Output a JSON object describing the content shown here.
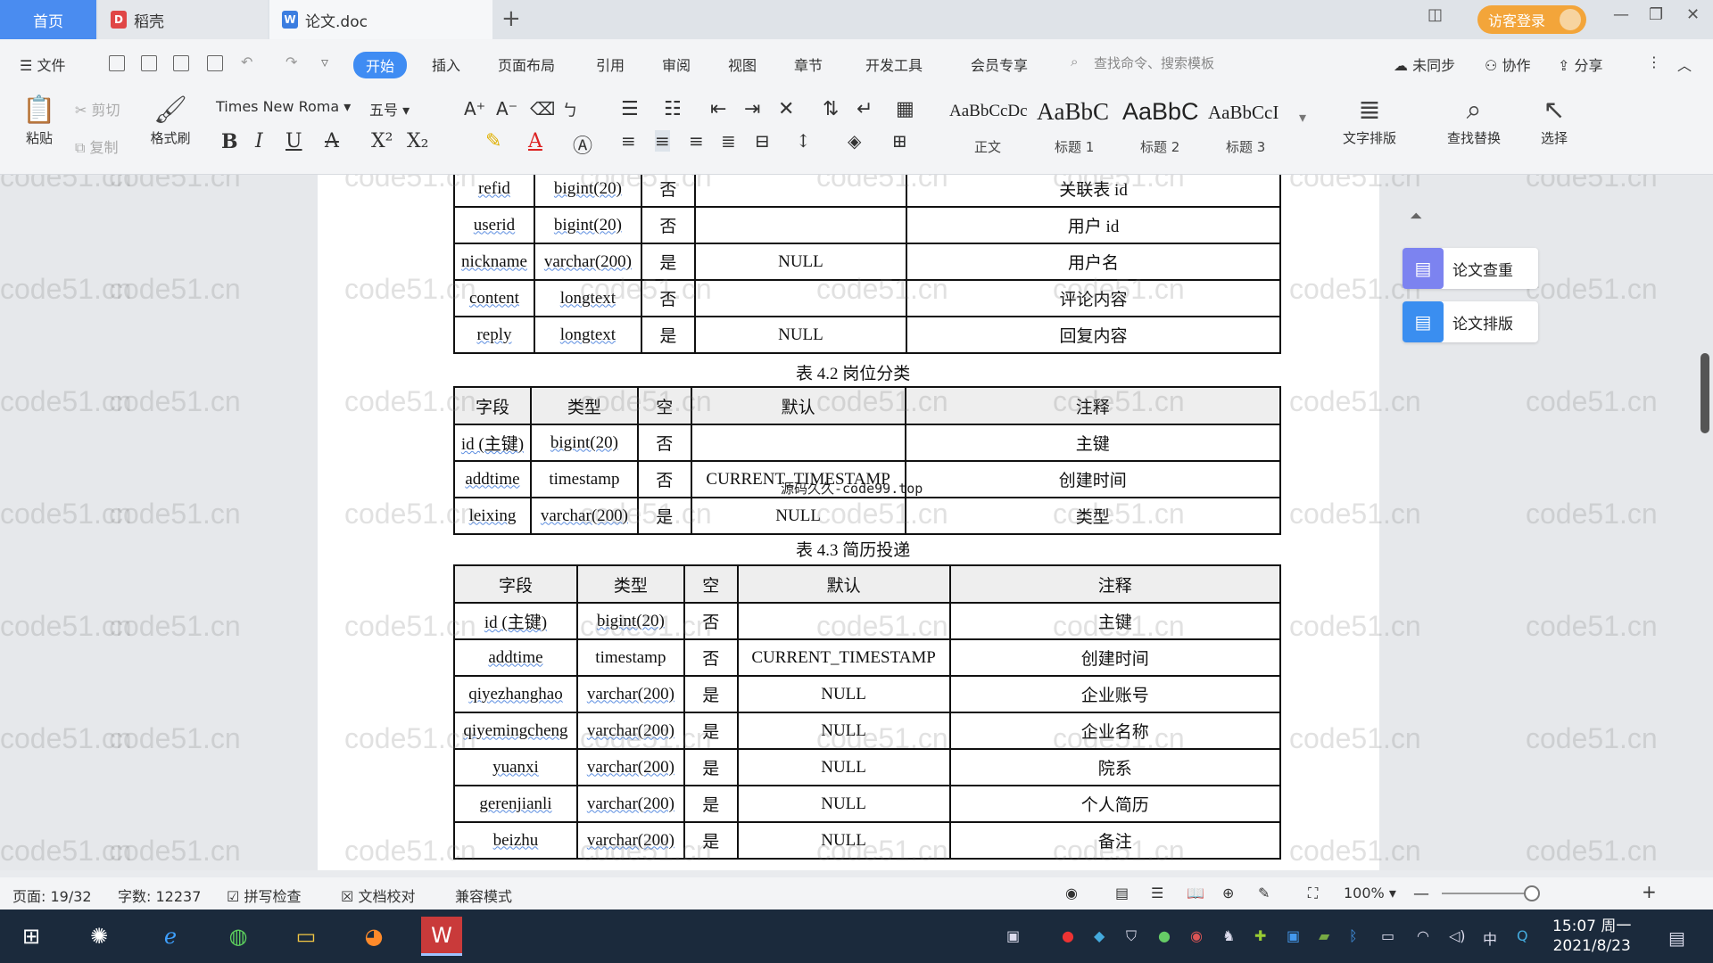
{
  "tabs": {
    "home": "首页",
    "docer": "稻壳",
    "doc": "论文.doc",
    "login": "访客登录"
  },
  "menu": {
    "file": "文件",
    "items": [
      "开始",
      "插入",
      "页面布局",
      "引用",
      "审阅",
      "视图",
      "章节",
      "开发工具",
      "会员专享"
    ],
    "search": "查找命令、搜索模板",
    "sync": "未同步",
    "collab": "协作",
    "share": "分享"
  },
  "ribbon": {
    "paste": "粘贴",
    "cut": "剪切",
    "copy": "复制",
    "format_painter": "格式刷",
    "font_name": "Times New Roma",
    "font_size": "五号",
    "styles": [
      {
        "sample": "AaBbCcDc",
        "label": "正文"
      },
      {
        "sample": "AaBbC",
        "label": "标题 1"
      },
      {
        "sample": "AaBbC",
        "label": "标题 2"
      },
      {
        "sample": "AaBbCcI",
        "label": "标题 3"
      }
    ],
    "text_layout": "文字排版",
    "find_replace": "查找替换",
    "select": "选择"
  },
  "document": {
    "table1": {
      "rows": [
        [
          "refid",
          "bigint(20)",
          "否",
          "",
          "关联表 id"
        ],
        [
          "userid",
          "bigint(20)",
          "否",
          "",
          "用户 id"
        ],
        [
          "nickname",
          "varchar(200)",
          "是",
          "NULL",
          "用户名"
        ],
        [
          "content",
          "longtext",
          "否",
          "",
          "评论内容"
        ],
        [
          "reply",
          "longtext",
          "是",
          "NULL",
          "回复内容"
        ]
      ]
    },
    "table2": {
      "caption": "表 4.2 岗位分类",
      "headers": [
        "字段",
        "类型",
        "空",
        "默认",
        "注释"
      ],
      "rows": [
        [
          "id (主键)",
          "bigint(20)",
          "否",
          "",
          "主键"
        ],
        [
          "addtime",
          "timestamp",
          "否",
          "CURRENT_TIMESTAMP",
          "创建时间"
        ],
        [
          "leixing",
          "varchar(200)",
          "是",
          "NULL",
          "类型"
        ]
      ]
    },
    "table3": {
      "caption": "表 4.3 简历投递",
      "headers": [
        "字段",
        "类型",
        "空",
        "默认",
        "注释"
      ],
      "rows": [
        [
          "id (主键)",
          "bigint(20)",
          "否",
          "",
          "主键"
        ],
        [
          "addtime",
          "timestamp",
          "否",
          "CURRENT_TIMESTAMP",
          "创建时间"
        ],
        [
          "qiyezhanghao",
          "varchar(200)",
          "是",
          "NULL",
          "企业账号"
        ],
        [
          "qiyemingcheng",
          "varchar(200)",
          "是",
          "NULL",
          "企业名称"
        ],
        [
          "yuanxi",
          "varchar(200)",
          "是",
          "NULL",
          "院系"
        ],
        [
          "gerenjianli",
          "varchar(200)",
          "是",
          "NULL",
          "个人简历"
        ],
        [
          "beizhu",
          "varchar(200)",
          "是",
          "NULL",
          "备注"
        ]
      ]
    },
    "overlay_text": "源码久久-code99.top",
    "watermark": "code51.cn"
  },
  "sidepanel": {
    "check": "论文查重",
    "layout": "论文排版"
  },
  "status": {
    "page": "页面: 19/32",
    "words": "字数: 12237",
    "spell": "拼写检查",
    "proof": "文档校对",
    "compat": "兼容模式",
    "zoom": "100%"
  },
  "taskbar": {
    "time": "15:07 周一",
    "date": "2021/8/23",
    "ime": "中"
  }
}
